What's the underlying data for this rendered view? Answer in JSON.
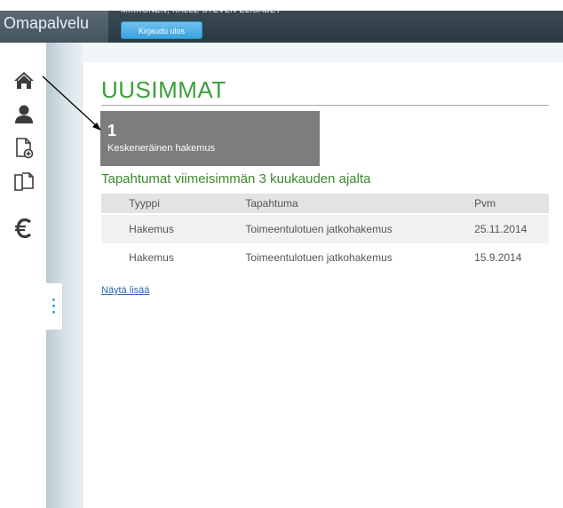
{
  "header": {
    "app_title": "Omapalvelu",
    "user_name": "MIKKONEN, KALLE STEVEN ELISABET",
    "logout_label": "Kirjaudu ulos"
  },
  "sidebar": {
    "items": [
      {
        "icon": "home-icon"
      },
      {
        "icon": "user-icon"
      },
      {
        "icon": "new-document-icon"
      },
      {
        "icon": "documents-icon"
      },
      {
        "icon": "euro-icon"
      }
    ]
  },
  "main": {
    "title": "UUSIMMAT",
    "pending": {
      "count": "1",
      "label": "Keskeneräinen hakemus"
    },
    "events_title": "Tapahtumat viimeisimmän 3 kuukauden ajalta",
    "columns": [
      "Tyyppi",
      "Tapahtuma",
      "Pvm"
    ],
    "rows": [
      {
        "type": "Hakemus",
        "event": "Toimeentulotuen jatkohakemus",
        "date": "25.11.2014"
      },
      {
        "type": "Hakemus",
        "event": "Toimeentulotuen jatkohakemus",
        "date": "15.9.2014"
      }
    ],
    "show_more": "Näytä lisää"
  },
  "colors": {
    "accent_green": "#3aa03a",
    "header_dark": "#2b3942",
    "button_blue": "#3ba3df"
  }
}
